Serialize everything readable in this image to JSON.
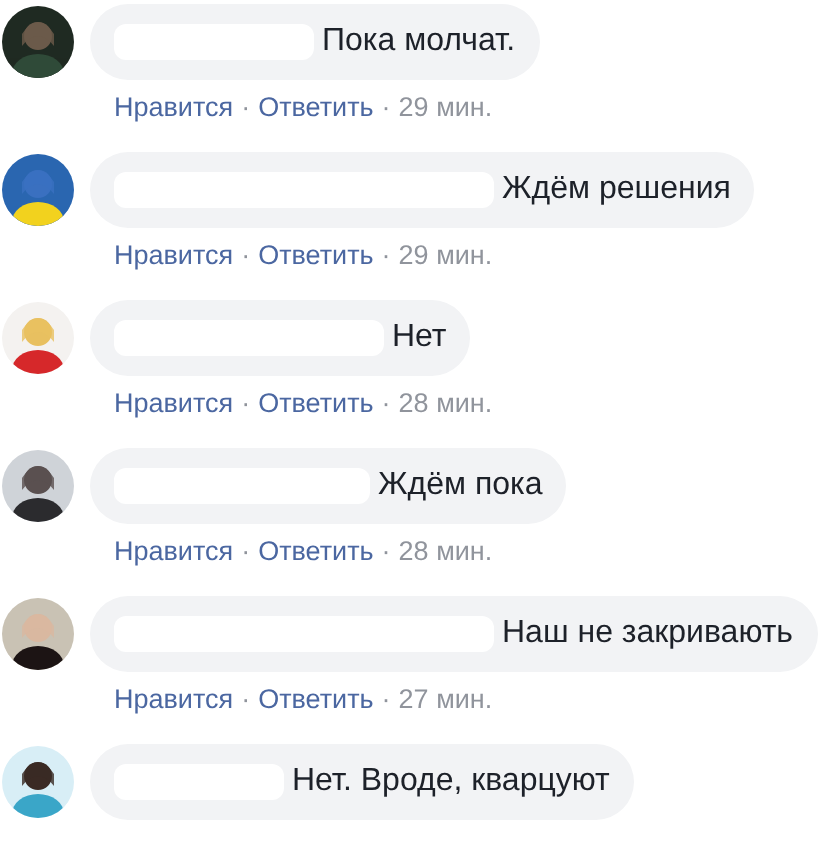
{
  "comments": [
    {
      "name_redacted": true,
      "text": "Пока молчат.",
      "actions": [
        "Нравится",
        "Ответить"
      ],
      "separator": "·",
      "time": "29 мин."
    },
    {
      "name_redacted": true,
      "text": "Ждём решения",
      "actions": [
        "Нравится",
        "Ответить"
      ],
      "separator": "·",
      "time": "29 мин."
    },
    {
      "name_redacted": true,
      "text": "Нет",
      "actions": [
        "Нравится",
        "Ответить"
      ],
      "separator": "·",
      "time": "28 мин."
    },
    {
      "name_redacted": true,
      "text": "Ждём пока",
      "actions": [
        "Нравится",
        "Ответить"
      ],
      "separator": "·",
      "time": "28 мин."
    },
    {
      "name_redacted": true,
      "text": "Наш не закривають",
      "actions": [
        "Нравится",
        "Ответить"
      ],
      "separator": "·",
      "time": "27 мин."
    },
    {
      "name_redacted": true,
      "text": "Нет. Вроде, кварцуют"
    }
  ]
}
